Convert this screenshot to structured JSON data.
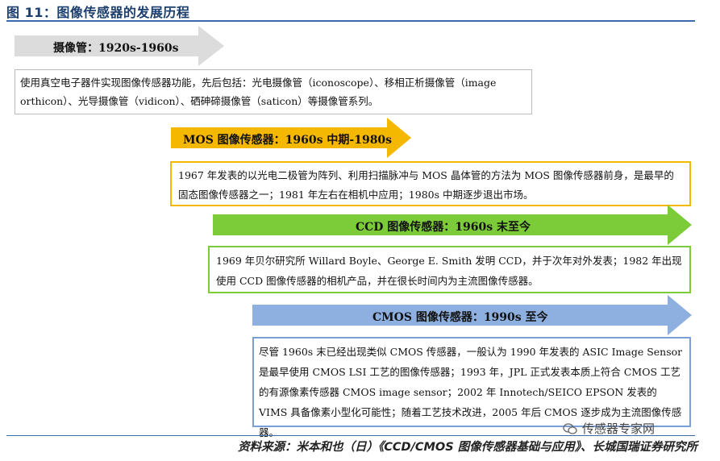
{
  "figure": {
    "title": "图 11：图像传感器的发展历程",
    "source": "资料来源：米本和也（日）《CCD/CMOS 图像传感器基础与应用》、长城国瑞证券研究所",
    "watermark": "传感器专家网"
  },
  "stages": [
    {
      "label": "摄像管：1920s-1960s",
      "color": "#dcdcdc",
      "text": "使用真空电子器件实现图像传感器功能，先后包括：光电摄像管（iconoscope）、移相正析摄像管（image orthicon）、光导摄像管（vidicon）、硒砷碲摄像管（saticon）等摄像管系列。"
    },
    {
      "label": "MOS 图像传感器：1960s 中期-1980s",
      "color": "#f5b800",
      "text": "1967 年发表的以光电二极管为阵列、利用扫描脉冲与 MOS 晶体管的方法为 MOS 图像传感器前身，是最早的固态图像传感器之一；1981 年左右在相机中应用；1980s 中期逐步退出市场。"
    },
    {
      "label": "CCD 图像传感器：1960s 末至今",
      "color": "#7ccc3a",
      "text": "1969 年贝尔研究所 Willard Boyle、George E. Smith 发明 CCD，并于次年对外发表；1982 年出现使用 CCD 图像传感器的相机产品，并在很长时间内为主流图像传感器。"
    },
    {
      "label": "CMOS 图像传感器：1990s 至今",
      "color": "#8eb0e0",
      "text": "尽管 1960s 末已经出现类似 CMOS 传感器，一般认为 1990 年发表的 ASIC Image Sensor 是最早使用 CMOS LSI 工艺的图像传感器；1993 年，JPL 正式发表本质上符合 CMOS 工艺的有源像素传感器 CMOS image sensor；2002 年 Innotech/SEICO EPSON 发表的 VIMS 具备像素小型化可能性；随着工艺技术改进，2005 年后 CMOS 逐步成为主流图像传感器。"
    }
  ]
}
